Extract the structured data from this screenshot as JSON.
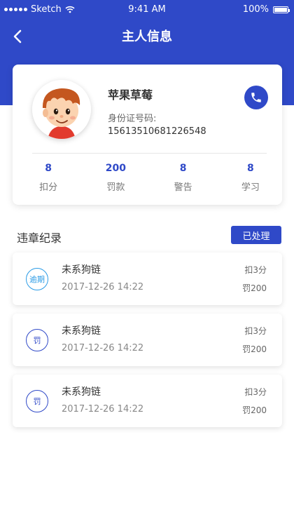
{
  "status_bar": {
    "carrier": "Sketch",
    "time": "9:41 AM",
    "battery": "100%"
  },
  "nav": {
    "title": "主人信息",
    "back_icon": "chevron-left-icon"
  },
  "profile": {
    "name": "苹果草莓",
    "id_label": "身份证号码:",
    "id_number": "15613510681226548",
    "phone_icon": "phone-icon",
    "stats": [
      {
        "value": "8",
        "label": "扣分"
      },
      {
        "value": "200",
        "label": "罚款"
      },
      {
        "value": "8",
        "label": "警告"
      },
      {
        "value": "8",
        "label": "学习"
      }
    ]
  },
  "records_section": {
    "title": "违章纪录",
    "status_badge": "已处理"
  },
  "records": [
    {
      "badge": "逾期",
      "title": "未系狗链",
      "time": "2017-12-26 14:22",
      "points": "扣3分",
      "fine": "罚200"
    },
    {
      "badge": "罚",
      "title": "未系狗链",
      "time": "2017-12-26 14:22",
      "points": "扣3分",
      "fine": "罚200"
    },
    {
      "badge": "罚",
      "title": "未系狗链",
      "time": "2017-12-26 14:22",
      "points": "扣3分",
      "fine": "罚200"
    }
  ],
  "colors": {
    "primary": "#2f49c8",
    "overdue": "#2a9be6",
    "background": "#ffffff"
  }
}
